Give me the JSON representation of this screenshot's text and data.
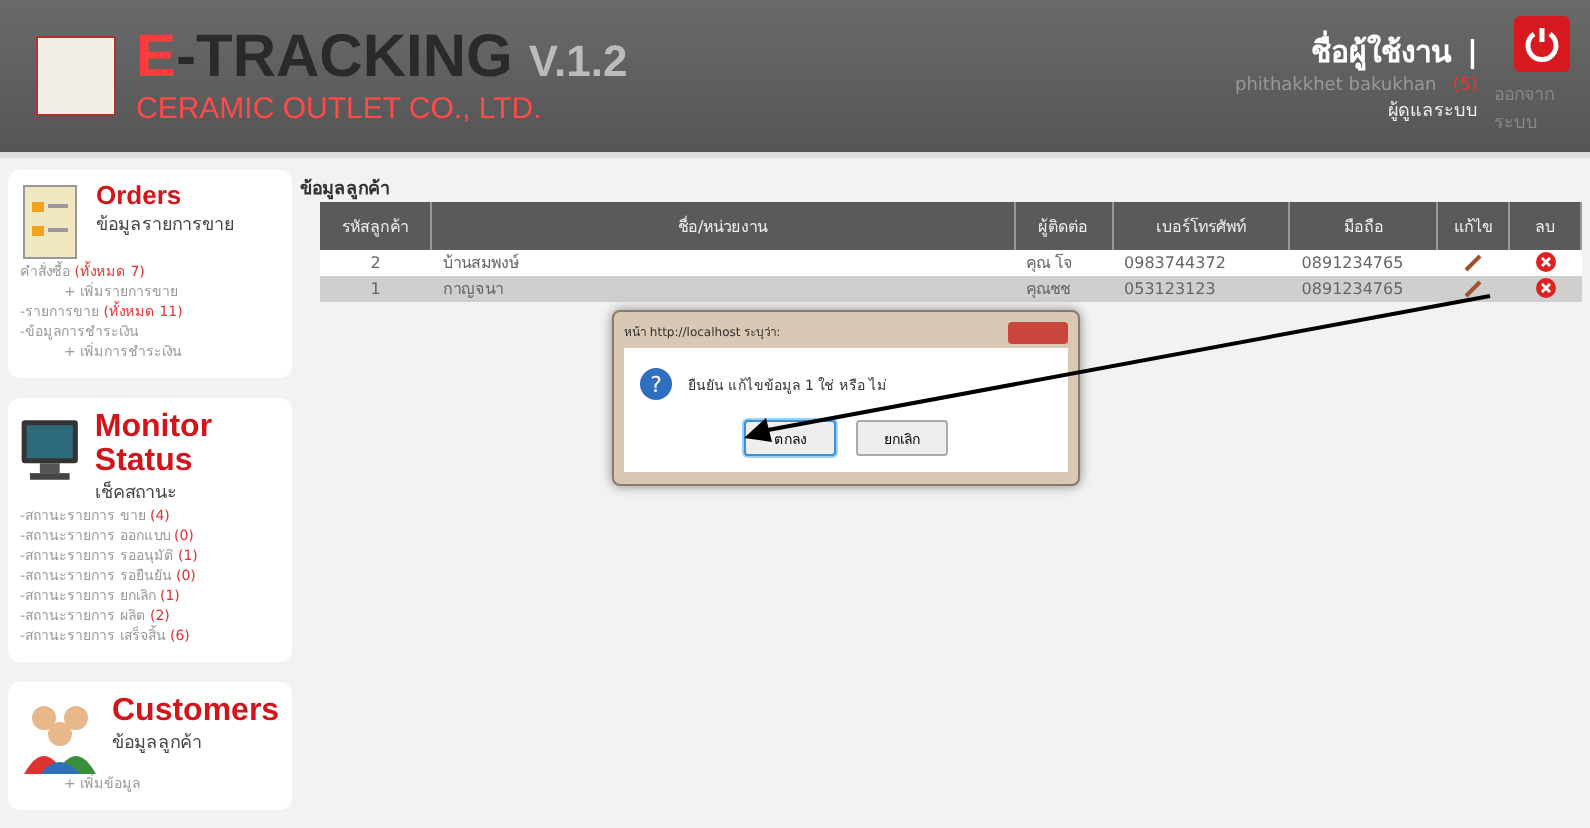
{
  "header": {
    "brand_initial": "E",
    "brand_rest": "-TRACKING",
    "version": "V.1.2",
    "company": "CERAMIC OUTLET CO., LTD.",
    "user_label": "ชื่อผู้ใช้งาน",
    "separator": "|",
    "user_name": "phithakkhet  bakukhan",
    "user_count": "(5)",
    "role": "ผู้ดูแลระบบ",
    "logout": "ออกจากระบบ"
  },
  "sidebar": [
    {
      "kind": "orders",
      "title": "Orders",
      "subtitle": "ข้อมูลรายการขาย",
      "links": [
        {
          "text": "คำสั่งซื้อ",
          "count": "(ทั้งหมด 7)",
          "sub": false
        },
        {
          "text": "+ เพิ่มรายการขาย",
          "sub": true
        },
        {
          "text": "-รายการขาย",
          "count": "(ทั้งหมด 11)",
          "sub": false
        },
        {
          "text": "-ข้อมูลการชำระเงิน",
          "sub": false
        },
        {
          "text": "+ เพิ่มการชำระเงิน",
          "sub": true
        }
      ]
    },
    {
      "kind": "monitor",
      "title": "Monitor Status",
      "subtitle": "เช็คสถานะ",
      "links": [
        {
          "text": "-สถานะรายการ ขาย",
          "count": "(4)",
          "sub": false
        },
        {
          "text": "-สถานะรายการ ออกแบบ",
          "count": "(0)",
          "sub": false
        },
        {
          "text": "-สถานะรายการ รออนุมัติ",
          "count": "(1)",
          "sub": false
        },
        {
          "text": "-สถานะรายการ รอยืนยัน",
          "count": "(0)",
          "sub": false
        },
        {
          "text": "-สถานะรายการ ยกเลิก",
          "count": "(1)",
          "sub": false
        },
        {
          "text": "-สถานะรายการ ผลิต",
          "count": "(2)",
          "sub": false
        },
        {
          "text": "-สถานะรายการ เสร็จสิ้น",
          "count": "(6)",
          "sub": false
        }
      ]
    },
    {
      "kind": "customers",
      "title": "Customers",
      "subtitle": "ข้อมูลลูกค้า",
      "links": [
        {
          "text": "+ เพิ่มข้อมูล",
          "sub": true
        }
      ]
    }
  ],
  "main": {
    "title": "ข้อมูลลูกค้า",
    "columns": [
      "รหัสลูกค้า",
      "ชื่อ/หน่วยงาน",
      "ผู้ติดต่อ",
      "เบอร์โทรศัพท์",
      "มือถือ",
      "แก้ไข",
      "ลบ"
    ],
    "rows": [
      {
        "id": "2",
        "name": "บ้านสมพงษ์",
        "contact": "คุณ โจ",
        "phone": "0983744372",
        "mobile": "0891234765",
        "selected": false
      },
      {
        "id": "1",
        "name": "กาญจนา",
        "contact": "คุณชช",
        "phone": "053123123",
        "mobile": "0891234765",
        "selected": true
      }
    ]
  },
  "dialog": {
    "icon": "?",
    "title": "หน้า http://localhost ระบุว่า:",
    "message": "ยืนยัน แก้ไขข้อมูล 1 ใช่ หรือ ไม่",
    "buttons": [
      {
        "label": "ตกลง",
        "selected": true
      },
      {
        "label": "ยกเลิก",
        "selected": false
      }
    ]
  }
}
